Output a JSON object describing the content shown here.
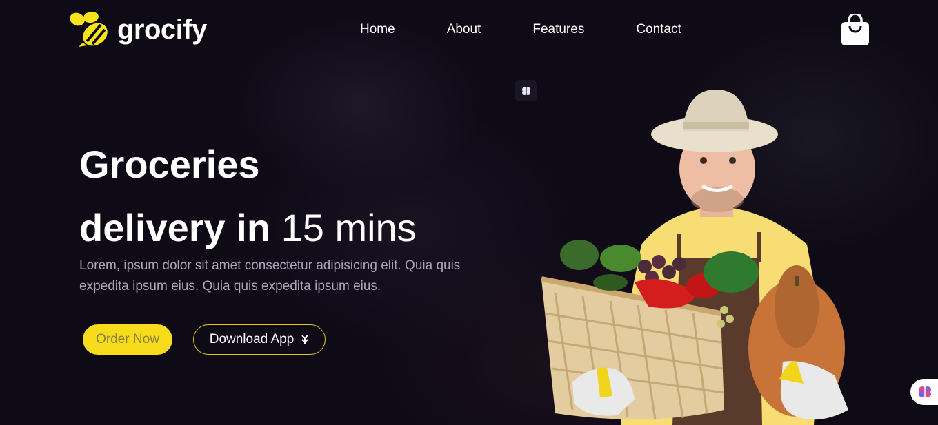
{
  "brand": {
    "name": "grocify",
    "accent": "#f6e31c"
  },
  "nav": {
    "items": [
      {
        "label": "Home"
      },
      {
        "label": "About"
      },
      {
        "label": "Features"
      },
      {
        "label": "Contact"
      }
    ]
  },
  "header": {
    "cart_icon": "shopping-bag-icon"
  },
  "hero": {
    "title_line1": "Groceries",
    "title_line2_bold": "delivery in",
    "title_line2_light": "15 mins",
    "description": "Lorem, ipsum dolor sit amet consectetur adipisicing elit. Quia quis expedita ipsum eius. Quia quis expedita ipsum eius.",
    "order_button": "Order Now",
    "download_button": "Download App",
    "download_icon": "double-chevron-down-icon",
    "image": "grocer-with-vegetable-basket"
  },
  "colors": {
    "background": "#0f0b18",
    "button_primary": "#f6dc1c",
    "button_primary_text": "#8a7f38",
    "button_outline": "#e2c91f",
    "paragraph": "#a9a6b8"
  }
}
